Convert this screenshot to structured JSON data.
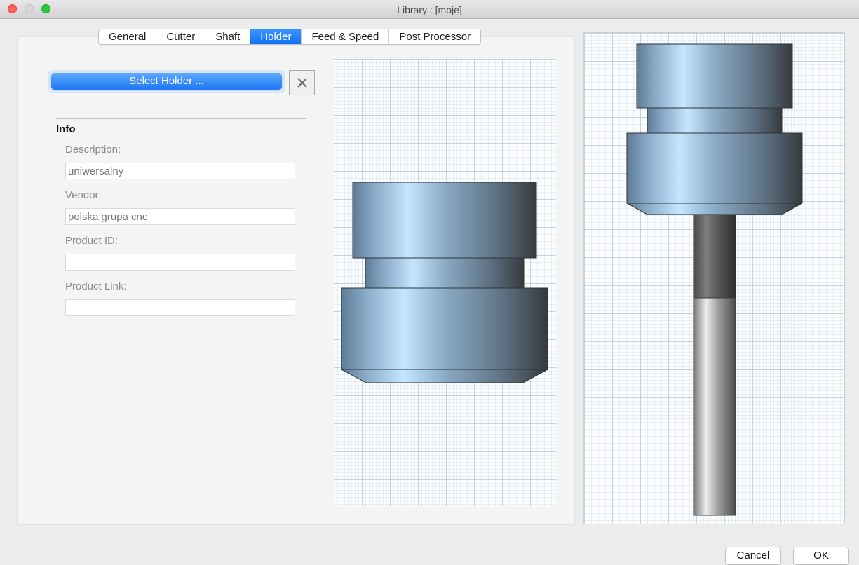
{
  "window": {
    "title": "Library : [moje]"
  },
  "tabs": [
    {
      "label": "General",
      "active": false
    },
    {
      "label": "Cutter",
      "active": false
    },
    {
      "label": "Shaft",
      "active": false
    },
    {
      "label": "Holder",
      "active": true
    },
    {
      "label": "Feed & Speed",
      "active": false
    },
    {
      "label": "Post Processor",
      "active": false
    }
  ],
  "holder": {
    "select_label": "Select Holder ...",
    "clear_icon": "close-icon"
  },
  "info": {
    "heading": "Info",
    "description_label": "Description:",
    "description_value": "uniwersalny",
    "vendor_label": "Vendor:",
    "vendor_value": "polska grupa cnc",
    "product_id_label": "Product ID:",
    "product_id_value": "",
    "product_link_label": "Product Link:",
    "product_link_value": ""
  },
  "footer": {
    "cancel_label": "Cancel",
    "ok_label": "OK"
  },
  "colors": {
    "accent": "#1b77f3",
    "holder_light": "#c4e6ff",
    "holder_dark": "#363a3d"
  }
}
